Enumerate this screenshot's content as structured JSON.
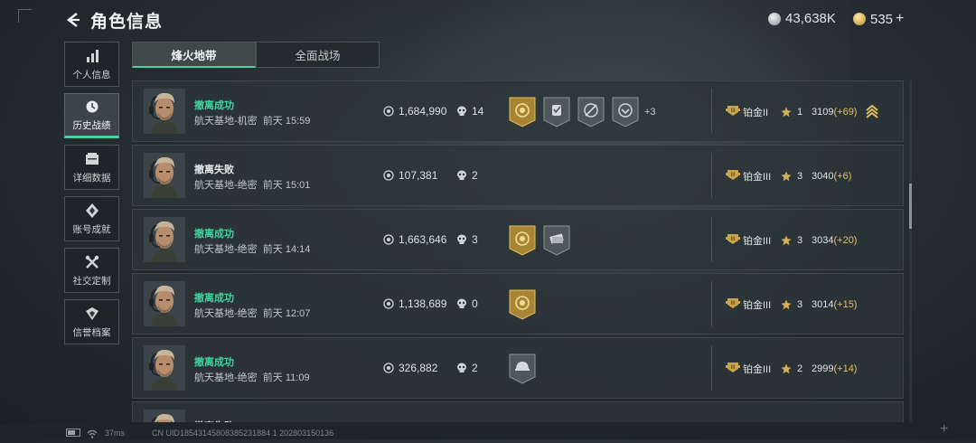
{
  "header": {
    "title": "角色信息"
  },
  "currency": {
    "silver": "43,638K",
    "gold": "535",
    "plus": "+"
  },
  "sidebar": {
    "items": [
      {
        "label": "个人信息",
        "icon": "bar-chart-icon",
        "active": false
      },
      {
        "label": "历史战绩",
        "icon": "clock-icon",
        "active": true
      },
      {
        "label": "详细数据",
        "icon": "folder-icon",
        "active": false
      },
      {
        "label": "账号成就",
        "icon": "medal-icon",
        "active": false
      },
      {
        "label": "社交定制",
        "icon": "tools-icon",
        "active": false
      },
      {
        "label": "信誉档案",
        "icon": "shield-icon",
        "active": false
      }
    ]
  },
  "tabs": [
    {
      "label": "烽火地带",
      "active": true
    },
    {
      "label": "全面战场",
      "active": false
    }
  ],
  "records": [
    {
      "result": "撤离成功",
      "success": true,
      "map": "航天基地-机密",
      "time": "前天 15:59",
      "worth": "1,684,990",
      "kills": "14",
      "badges": [
        "gold-emblem-badge",
        "gray-hand-badge",
        "gray-target-badge",
        "gray-eagle-badge"
      ],
      "more": "+3",
      "rank": "铂金II",
      "stars": "1",
      "score": "3109",
      "delta": "(+69)",
      "rank_up": true
    },
    {
      "result": "撤离失败",
      "success": false,
      "map": "航天基地-绝密",
      "time": "前天 15:01",
      "worth": "107,381",
      "kills": "2",
      "badges": [],
      "more": "",
      "rank": "铂金III",
      "stars": "3",
      "score": "3040",
      "delta": "(+6)",
      "rank_up": false
    },
    {
      "result": "撤离成功",
      "success": true,
      "map": "航天基地-绝密",
      "time": "前天 14:14",
      "worth": "1,663,646",
      "kills": "3",
      "badges": [
        "gold-emblem-badge",
        "gray-cash-badge"
      ],
      "more": "",
      "rank": "铂金III",
      "stars": "3",
      "score": "3034",
      "delta": "(+20)",
      "rank_up": false
    },
    {
      "result": "撤离成功",
      "success": true,
      "map": "航天基地-绝密",
      "time": "前天 12:07",
      "worth": "1,138,689",
      "kills": "0",
      "badges": [
        "gold-emblem-badge"
      ],
      "more": "",
      "rank": "铂金III",
      "stars": "3",
      "score": "3014",
      "delta": "(+15)",
      "rank_up": false
    },
    {
      "result": "撤离成功",
      "success": true,
      "map": "航天基地-绝密",
      "time": "前天 11:09",
      "worth": "326,882",
      "kills": "2",
      "badges": [
        "gray-helmet-badge"
      ],
      "more": "",
      "rank": "铂金III",
      "stars": "2",
      "score": "2999",
      "delta": "(+14)",
      "rank_up": false
    },
    {
      "result": "撤离失败",
      "success": false,
      "map": "",
      "time": "",
      "worth": "",
      "kills": "",
      "badges": [],
      "more": "",
      "rank": "",
      "stars": "",
      "score": "",
      "delta": "",
      "rank_up": false
    }
  ],
  "footer": {
    "ping": "37ms",
    "uid": "CN UID18543145808385231884 1 202803150136"
  },
  "colors": {
    "accent": "#3fd6a1",
    "delta": "#e7c15a",
    "gold": "#c9a44a"
  }
}
